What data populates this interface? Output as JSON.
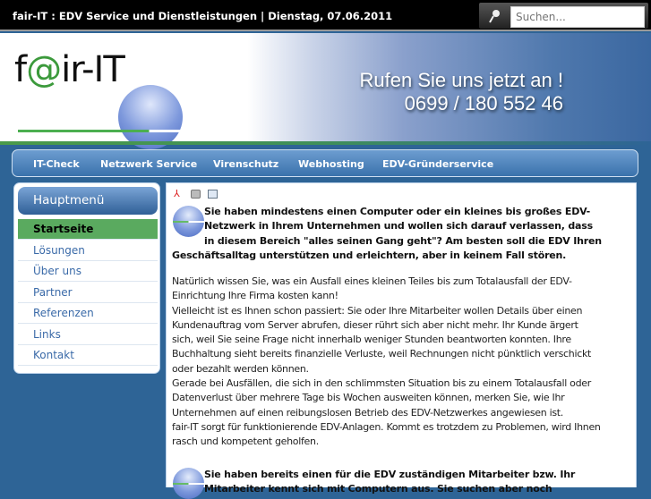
{
  "topbar": {
    "title": "fair-IT : EDV Service und Dienstleistungen | Dienstag, 07.06.2011",
    "search_placeholder": "Suchen..."
  },
  "header": {
    "logo": "f@ir-IT",
    "slogan": "Rufen Sie uns jetzt an !",
    "phone": "0699 / 180 552 46"
  },
  "nav": [
    "IT-Check",
    "Netzwerk Service",
    "Virenschutz",
    "Webhosting",
    "EDV-Gründerservice"
  ],
  "sidebar": {
    "title": "Hauptmenü",
    "items": [
      "Startseite",
      "Lösungen",
      "Über uns",
      "Partner",
      "Referenzen",
      "Links",
      "Kontakt"
    ]
  },
  "content": {
    "intro_lines": [
      "Sie haben mindestens einen Computer oder ein kleines bis großes EDV-",
      "Netzwerk in Ihrem Unternehmen und wollen sich darauf verlassen, dass",
      "in diesem Bereich \"alles seinen Gang geht\"? Am besten soll die EDV Ihren",
      "Geschäftsalltag unterstützen und erleichtern, aber in keinem Fall stören."
    ],
    "body_lines": [
      "Natürlich wissen Sie, was ein Ausfall eines kleinen Teiles bis zum Totalausfall der EDV-",
      "Einrichtung Ihre Firma kosten kann!",
      "Vielleicht ist es Ihnen schon passiert: Sie oder Ihre Mitarbeiter wollen Details über einen",
      "Kundenauftrag vom Server abrufen, dieser rührt sich aber nicht mehr. Ihr Kunde ärgert",
      "sich, weil Sie seine Frage nicht innerhalb weniger Stunden beantworten konnten. Ihre",
      "Buchhaltung sieht bereits finanzielle Verluste, weil Rechnungen nicht pünktlich verschickt",
      "oder bezahlt werden können.",
      "Gerade bei Ausfällen, die sich in den schlimmsten Situation bis zu einem Totalausfall oder",
      "Datenverlust über mehrere Tage bis Wochen ausweiten können, merken Sie, wie Ihr",
      "Unternehmen auf einen reibungslosen Betrieb des EDV-Netzwerkes angewiesen ist.",
      "fair-IT sorgt für funktionierende EDV-Anlagen. Kommt es trotzdem zu Problemen, wird Ihnen",
      "rasch und kompetent geholfen."
    ],
    "second_lines": [
      "Sie haben bereits einen für die EDV zuständigen Mitarbeiter bzw. Ihr",
      "Mitarbeiter kennt sich mit Computern aus. Sie suchen aber noch"
    ]
  }
}
